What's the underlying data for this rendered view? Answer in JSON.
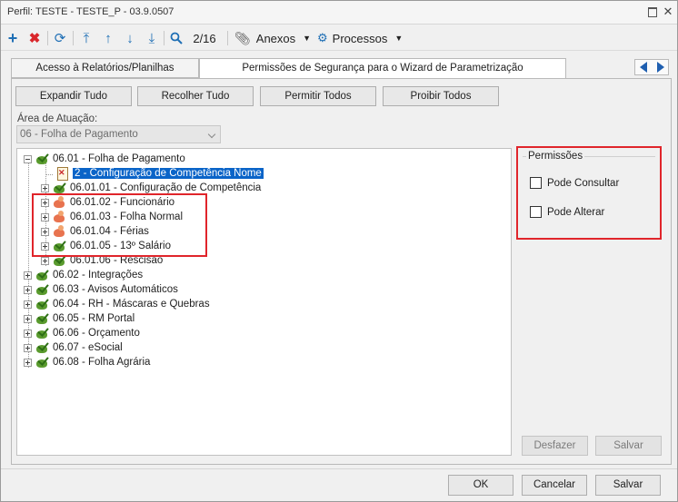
{
  "window": {
    "title": "Perfil: TESTE - TESTE_P - 03.9.0507"
  },
  "toolbar": {
    "page_indicator": "2/16",
    "anexos_label": "Anexos",
    "processos_label": "Processos"
  },
  "tabs": [
    {
      "label": "Acesso à Relatórios/Planilhas"
    },
    {
      "label": "Permissões de Segurança para o Wizard de Parametrização"
    }
  ],
  "actions": {
    "expandir": "Expandir Tudo",
    "recolher": "Recolher Tudo",
    "permitir": "Permitir Todos",
    "proibir": "Proibir Todos"
  },
  "area": {
    "label": "Área de Atuação:",
    "value": "06 - Folha de Pagamento"
  },
  "tree": [
    {
      "label": "06.01 - Folha de Pagamento"
    },
    {
      "label": "2 - Configuração de Competência Nome"
    },
    {
      "label": "06.01.01 - Configuração de Competência"
    },
    {
      "label": "06.01.02 - Funcionário"
    },
    {
      "label": "06.01.03 - Folha Normal"
    },
    {
      "label": "06.01.04 - Férias"
    },
    {
      "label": "06.01.05 - 13º Salário"
    },
    {
      "label": "06.01.06 - Rescisão"
    },
    {
      "label": "06.02 - Integrações"
    },
    {
      "label": "06.03 - Avisos Automáticos"
    },
    {
      "label": "06.04 - RH - Máscaras e Quebras"
    },
    {
      "label": "06.05 - RM Portal"
    },
    {
      "label": "06.06 - Orçamento"
    },
    {
      "label": "06.07 - eSocial"
    },
    {
      "label": "06.08 - Folha Agrária"
    }
  ],
  "permissions": {
    "title": "Permissões",
    "consultar": "Pode Consultar",
    "alterar": "Pode Alterar"
  },
  "panel_buttons": {
    "desfazer": "Desfazer",
    "salvar": "Salvar"
  },
  "footer": {
    "ok": "OK",
    "cancelar": "Cancelar",
    "salvar": "Salvar"
  },
  "colors": {
    "highlight": "#e0252b",
    "selection": "#0a64c8",
    "accent": "#1f6fb5"
  }
}
